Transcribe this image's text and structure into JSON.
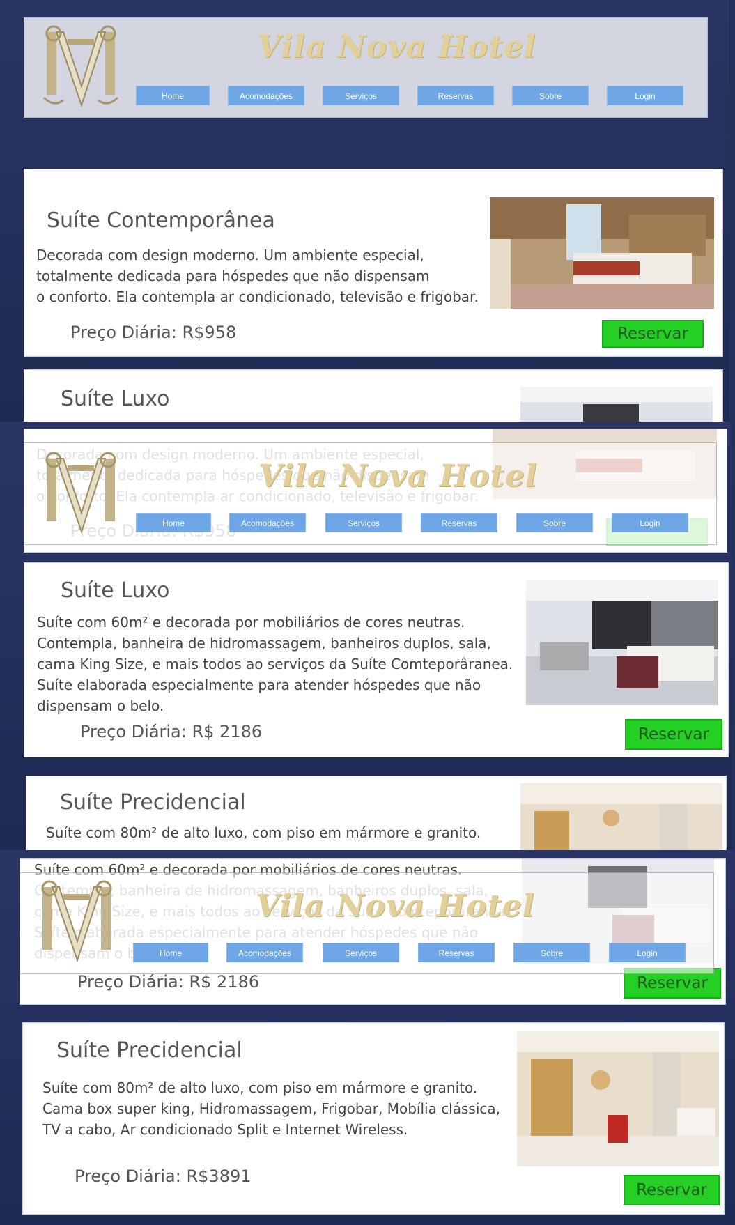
{
  "header": {
    "title": "Vila Nova Hotel",
    "nav": [
      "Home",
      "Acomodações",
      "Serviços",
      "Reservas",
      "Sobre",
      "Login"
    ]
  },
  "rooms": [
    {
      "title": "Suíte Contemporânea",
      "lines": [
        "Decorada com design moderno. Um ambiente especial,",
        "totalmente dedicada para hóspedes que não dispensam",
        "o conforto. Ela contempla  ar condicionado, televisão e frigobar."
      ],
      "price": "Preço Diária: R$958",
      "button": "Reservar"
    },
    {
      "title": "Suíte Luxo",
      "lines": [
        "Suíte com 60m² e decorada por mobiliários de cores neutras.",
        "Contempla, banheira de hidromassagem, banheiros duplos, sala,",
        "cama King Size, e mais todos ao serviços da Suíte Comteporâranea.",
        "Suíte elaborada especialmente para atender hóspedes que não",
        "dispensam o belo."
      ],
      "price": "Preço Diária: R$ 2186",
      "button": "Reservar"
    },
    {
      "title": "Suíte Precidencial",
      "lines": [
        "Suíte com 80m² de alto luxo, com piso em mármore e granito.",
        "Cama box super king, Hidromassagem, Frigobar, Mobília clássica,",
        "TV a cabo, Ar condicionado Split e Internet Wireless."
      ],
      "price": "Preço Diária: R$3891",
      "button": "Reservar"
    }
  ],
  "colors": {
    "background": "#24305a",
    "nav_button": "#6fa6e6",
    "reserve_button": "#25d025",
    "title_gold": "#e2cf9a"
  },
  "icons": [
    "vn-monogram-logo"
  ]
}
